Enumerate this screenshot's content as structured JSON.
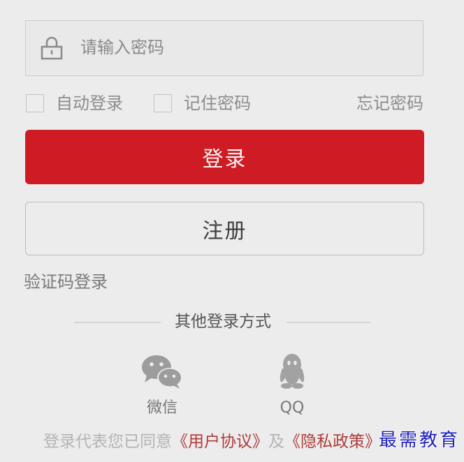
{
  "password": {
    "placeholder": "请输入密码",
    "value": "",
    "icon": "lock-icon"
  },
  "options": {
    "auto_login": {
      "label": "自动登录",
      "checked": false
    },
    "remember_password": {
      "label": "记住密码",
      "checked": false
    },
    "forgot_password": "忘记密码"
  },
  "buttons": {
    "login": "登录",
    "register": "注册"
  },
  "sms_login": "验证码登录",
  "other_login": {
    "title": "其他登录方式",
    "methods": [
      {
        "icon": "wechat-icon",
        "label": "微信"
      },
      {
        "icon": "qq-icon",
        "label": "QQ"
      }
    ]
  },
  "agreement": {
    "prefix": "登录代表您已同意",
    "user_agreement": "《用户协议》",
    "conjunction": "及",
    "privacy_policy": "《隐私政策》"
  },
  "watermark": "最需教育",
  "colors": {
    "accent": "#cf1c24",
    "background": "#ececec",
    "link": "#b03a3a"
  }
}
